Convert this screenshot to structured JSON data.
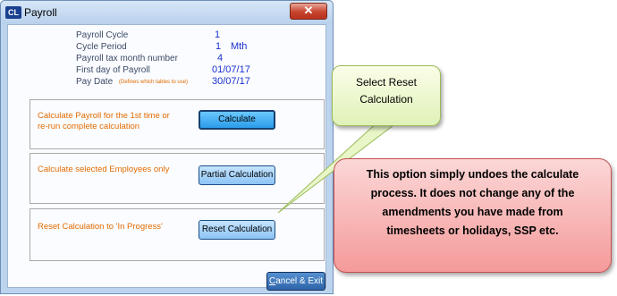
{
  "window": {
    "title": "Payroll",
    "app_icon_text": "CL",
    "close_glyph": "✕"
  },
  "info": {
    "payroll_cycle": {
      "label": "Payroll Cycle",
      "value": "1"
    },
    "cycle_period": {
      "label": "Cycle Period",
      "value": "1",
      "unit": "Mth"
    },
    "tax_month": {
      "label": "Payroll tax month number",
      "value": "4"
    },
    "first_day": {
      "label": "First day of Payroll",
      "value": "01/07/17"
    },
    "pay_date": {
      "label": "Pay Date",
      "hint": "(Defines which tables to use)",
      "value": "30/07/17"
    }
  },
  "groups": {
    "calculate": {
      "text_line1": "Calculate Payroll for the 1st time or",
      "text_line2": "re-run complete calculation",
      "button": "Calculate"
    },
    "partial": {
      "text": "Calculate selected Employees only",
      "button": "Partial Calculation"
    },
    "reset": {
      "text": "Reset Calculation to 'In Progress'",
      "button": "Reset Calculation"
    }
  },
  "cancel_button": {
    "mnemonic": "C",
    "rest": "ancel & Exit"
  },
  "callouts": {
    "green": {
      "line1": "Select Reset",
      "line2": "Calculation"
    },
    "red": {
      "line1": "This option simply undoes the calculate",
      "line2": "process. It does not change any of the",
      "line3": "amendments you have made from",
      "line4": "timesheets or holidays, SSP etc."
    }
  },
  "colors": {
    "value_blue": "#1a2fd0",
    "orange_text": "#e36b00",
    "green_callout": "#dff2b8",
    "red_callout": "#f59a9a"
  }
}
